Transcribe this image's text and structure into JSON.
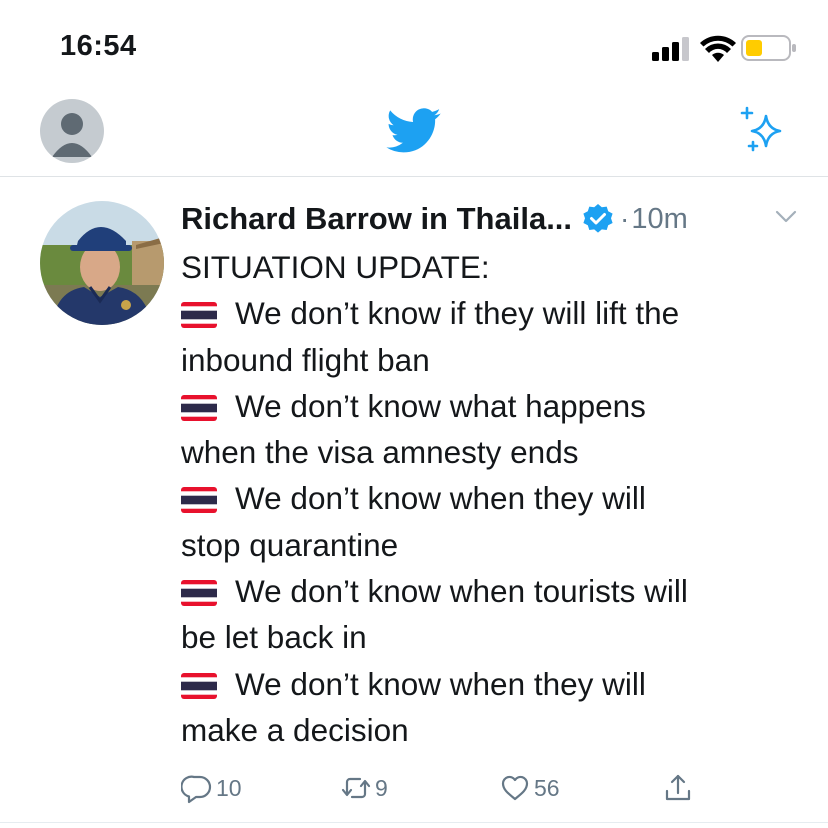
{
  "status_bar": {
    "time": "16:54",
    "icons": [
      "signal-icon",
      "wifi-icon",
      "battery-icon"
    ]
  },
  "header": {
    "icons": [
      "profile-avatar-icon",
      "twitter-bird-icon",
      "sparkle-icon"
    ],
    "brand_color": "#1da1f2"
  },
  "tweet": {
    "author_name": "Richard Barrow in Thaila...",
    "dot": "·",
    "timestamp": "10m",
    "lines": [
      "SITUATION UPDATE:",
      "We don’t know if they will lift the",
      "inbound flight ban",
      "We don’t know what happens",
      "when the visa amnesty ends",
      "We don’t know when they will",
      "stop quarantine",
      "We don’t know when tourists will",
      "be let back in",
      "We don’t know when they will",
      "make a decision"
    ],
    "actions": {
      "reply_count": "10",
      "retweet_count": "9",
      "like_count": "56"
    }
  },
  "colors": {
    "text": "#14171a",
    "secondary": "#657786",
    "accent": "#1da1f2",
    "battery_fill": "#ffcc00"
  }
}
